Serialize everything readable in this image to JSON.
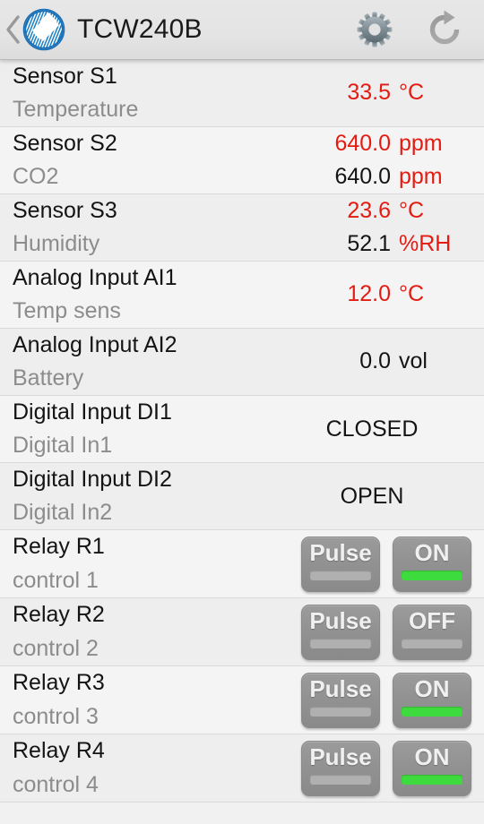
{
  "header": {
    "back_icon": "back-chevron-icon",
    "logo_icon": "app-logo-icon",
    "title": "TCW240B",
    "settings_icon": "gear-icon",
    "refresh_icon": "refresh-icon"
  },
  "colors": {
    "value_red": "#e51b12",
    "value_black": "#141414",
    "indicator_on": "#3ddb3d",
    "indicator_off": "#b0b0b0",
    "button_gray": "#929292",
    "row_bg": "#eeeeee",
    "row_bg_alt": "#f4f4f4",
    "header_bg": "#e4e4e4",
    "label_gray": "#8c8c8c"
  },
  "rows": [
    {
      "kind": "sensor",
      "title": "Sensor S1",
      "subtitle": "Temperature",
      "values": [
        {
          "number": "33.5",
          "number_color": "red",
          "unit": "°C",
          "unit_color": "red"
        }
      ]
    },
    {
      "kind": "sensor",
      "title": "Sensor S2",
      "subtitle": "CO2",
      "values": [
        {
          "number": "640.0",
          "number_color": "red",
          "unit": "ppm",
          "unit_color": "red"
        },
        {
          "number": "640.0",
          "number_color": "black",
          "unit": "ppm",
          "unit_color": "red"
        }
      ]
    },
    {
      "kind": "sensor",
      "title": "Sensor S3",
      "subtitle": "Humidity",
      "values": [
        {
          "number": "23.6",
          "number_color": "red",
          "unit": "°C",
          "unit_color": "red"
        },
        {
          "number": "52.1",
          "number_color": "black",
          "unit": "%RH",
          "unit_color": "red"
        }
      ]
    },
    {
      "kind": "sensor",
      "title": "Analog Input AI1",
      "subtitle": "Temp sens",
      "values": [
        {
          "number": "12.0",
          "number_color": "red",
          "unit": "°C",
          "unit_color": "red"
        }
      ]
    },
    {
      "kind": "sensor",
      "title": "Analog Input AI2",
      "subtitle": "Battery",
      "values": [
        {
          "number": "0.0",
          "number_color": "black",
          "unit": "vol",
          "unit_color": "black"
        }
      ]
    },
    {
      "kind": "state",
      "title": "Digital Input DI1",
      "subtitle": "Digital In1",
      "state": "CLOSED"
    },
    {
      "kind": "state",
      "title": "Digital Input DI2",
      "subtitle": "Digital In2",
      "state": "OPEN"
    },
    {
      "kind": "relay",
      "title": "Relay R1",
      "subtitle": "control 1",
      "pulse_label": "Pulse",
      "toggle_label": "ON",
      "toggle_on": true
    },
    {
      "kind": "relay",
      "title": "Relay R2",
      "subtitle": "control 2",
      "pulse_label": "Pulse",
      "toggle_label": "OFF",
      "toggle_on": false
    },
    {
      "kind": "relay",
      "title": "Relay R3",
      "subtitle": "control 3",
      "pulse_label": "Pulse",
      "toggle_label": "ON",
      "toggle_on": true
    },
    {
      "kind": "relay",
      "title": "Relay R4",
      "subtitle": "control 4",
      "pulse_label": "Pulse",
      "toggle_label": "ON",
      "toggle_on": true
    }
  ]
}
